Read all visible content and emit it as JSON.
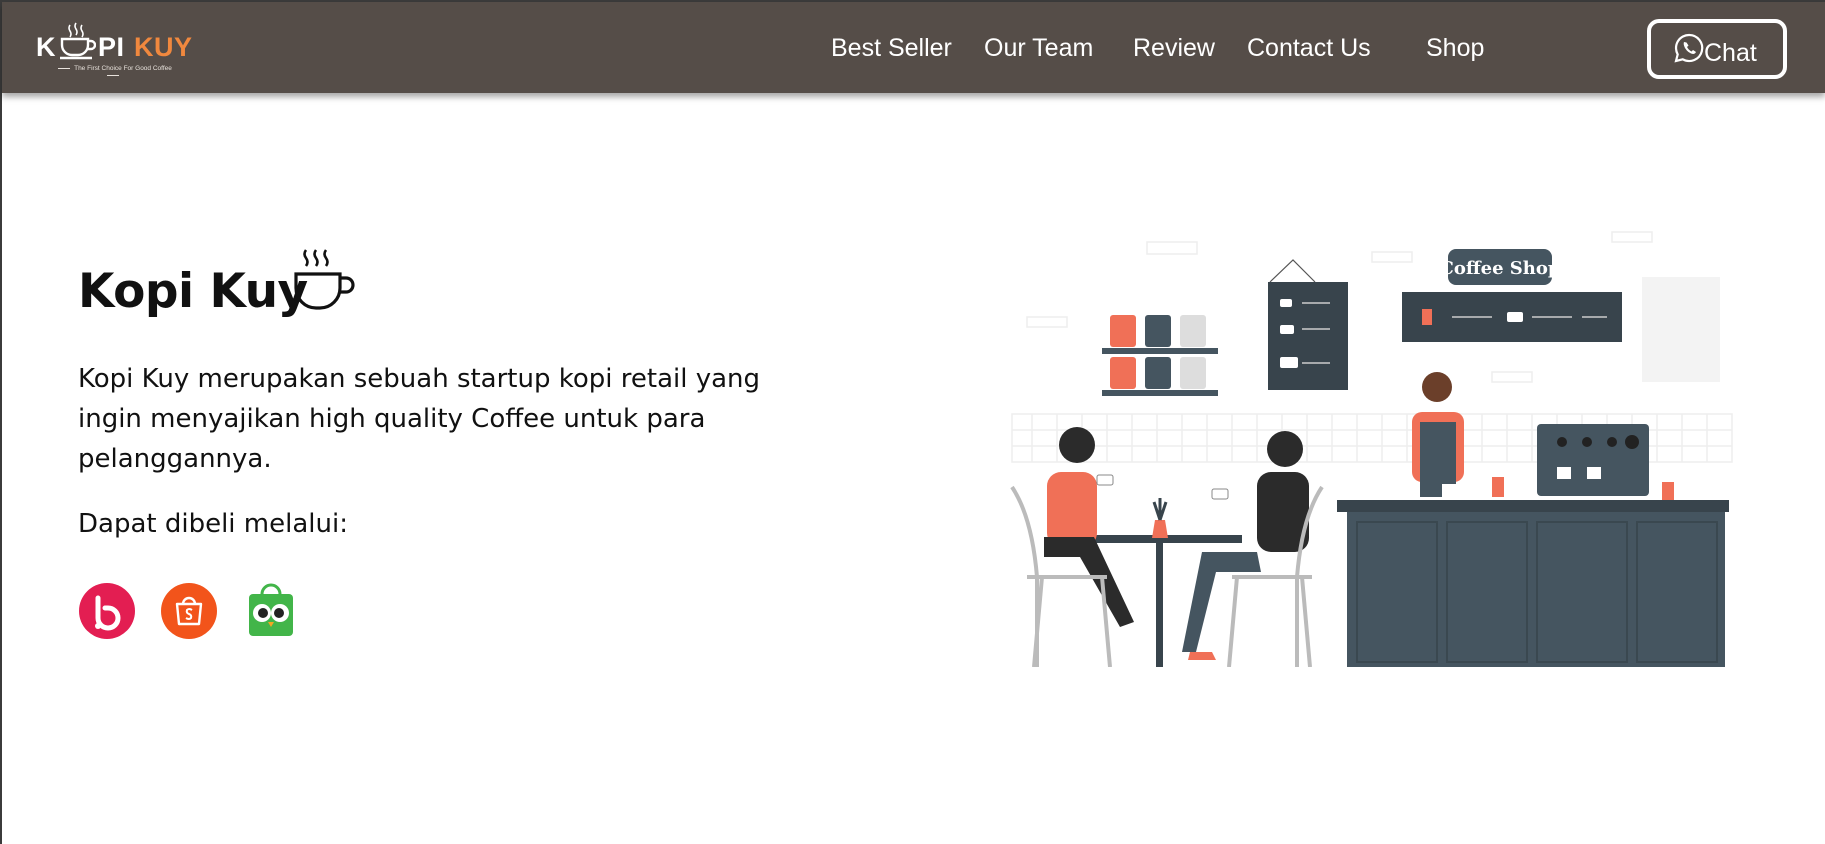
{
  "brand": {
    "name_part1": "K",
    "name_part2": "PI",
    "name_part3": "KUY",
    "tagline": "The First Choice For Good Coffee",
    "icon": "coffee-cup-icon",
    "accent": "#f0883e",
    "navbar_bg": "#554d48"
  },
  "nav": {
    "items": [
      {
        "label": "Best Seller"
      },
      {
        "label": "Our Team"
      },
      {
        "label": "Review"
      },
      {
        "label": "Contact Us"
      },
      {
        "label": "Shop"
      }
    ],
    "chat_label": "Chat",
    "chat_icon": "whatsapp-icon"
  },
  "hero": {
    "title": "Kopi Kuy",
    "title_icon": "hot-coffee-cup-icon",
    "description": "Kopi Kuy merupakan sebuah startup kopi retail yang ingin menyajikan high quality Coffee untuk para pelanggannya.",
    "buy_via": "Dapat dibeli melalui:",
    "stores": [
      {
        "name": "bukalapak",
        "icon": "bukalapak-icon",
        "color": "#e31e52"
      },
      {
        "name": "shopee",
        "icon": "shopee-icon",
        "color": "#f2541b"
      },
      {
        "name": "tokopedia",
        "icon": "tokopedia-icon",
        "color": "#42b549"
      }
    ]
  },
  "illustration": {
    "icon": "coffee-shop-illustration",
    "sign_text": "Coffee Shop"
  }
}
